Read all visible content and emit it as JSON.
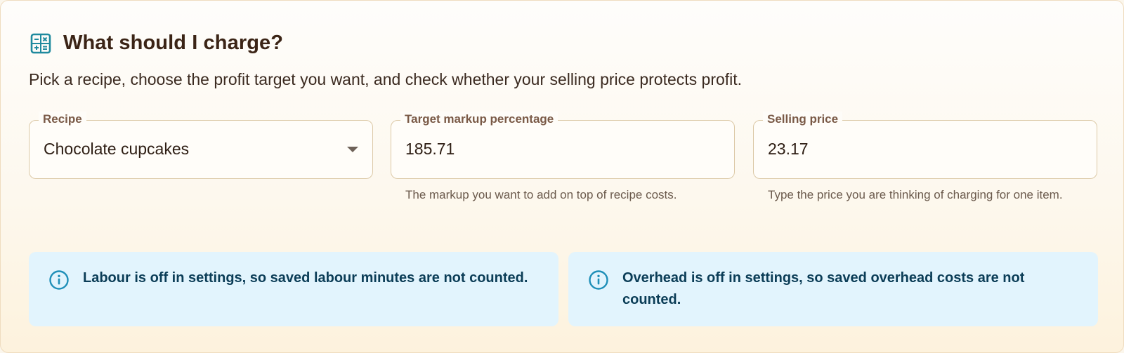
{
  "header": {
    "icon": "calculator-icon",
    "title": "What should I charge?",
    "subtitle": "Pick a recipe, choose the profit target you want, and check whether your selling price protects profit."
  },
  "fields": {
    "recipe": {
      "label": "Recipe",
      "value": "Chocolate cupcakes",
      "icon": "chevron-down-icon"
    },
    "markup": {
      "label": "Target markup percentage",
      "value": "185.71",
      "helper": "The markup you want to add on top of recipe costs."
    },
    "price": {
      "label": "Selling price",
      "value": "23.17",
      "helper": "Type the price you are thinking of charging for one item."
    }
  },
  "alerts": [
    {
      "icon": "info-icon",
      "text": "Labour is off in settings, so saved labour minutes are not counted."
    },
    {
      "icon": "info-icon",
      "text": "Overhead is off in settings, so saved overhead costs are not counted."
    }
  ],
  "colors": {
    "accent": "#1f8a9e",
    "title": "#3b2416",
    "info_bg": "#e2f4fd",
    "info_text": "#0b3d57",
    "info_icon": "#1f8fb8"
  }
}
